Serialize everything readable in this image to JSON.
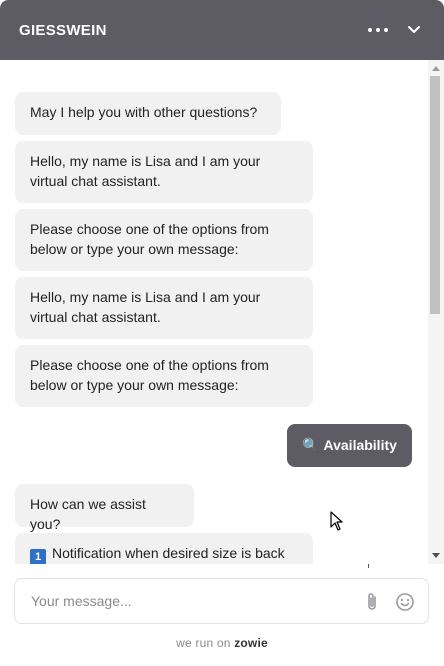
{
  "header": {
    "brand": "GIESSWEIN"
  },
  "messages": [
    {
      "from": "bot",
      "text": "May I help you with other questions?"
    },
    {
      "from": "bot",
      "text": "Hello, my name is Lisa and I am your virtual chat assistant."
    },
    {
      "from": "bot",
      "text": "Please choose one of the options from below or type your own message:"
    },
    {
      "from": "bot",
      "text": "Hello, my name is Lisa and I am your virtual chat assistant."
    },
    {
      "from": "bot",
      "text": "Please choose one of the options from below or type your own message:"
    },
    {
      "from": "user",
      "icon": "🔍",
      "text": "Availability"
    },
    {
      "from": "bot",
      "text": "How can we assist you?"
    },
    {
      "from": "bot",
      "number": "1",
      "text": "Notification when desired size is back"
    }
  ],
  "composer": {
    "placeholder": "Your message..."
  },
  "footer": {
    "prefix": "we run on",
    "brand": "zowie"
  },
  "icons": {
    "menu": "more-horizontal-icon",
    "collapse": "chevron-down-icon",
    "attach": "paperclip-icon",
    "emoji": "emoji-icon"
  },
  "colors": {
    "header_bg": "#5d5b63",
    "bot_bubble": "#f1f1f2",
    "user_bubble": "#5d5b63"
  }
}
